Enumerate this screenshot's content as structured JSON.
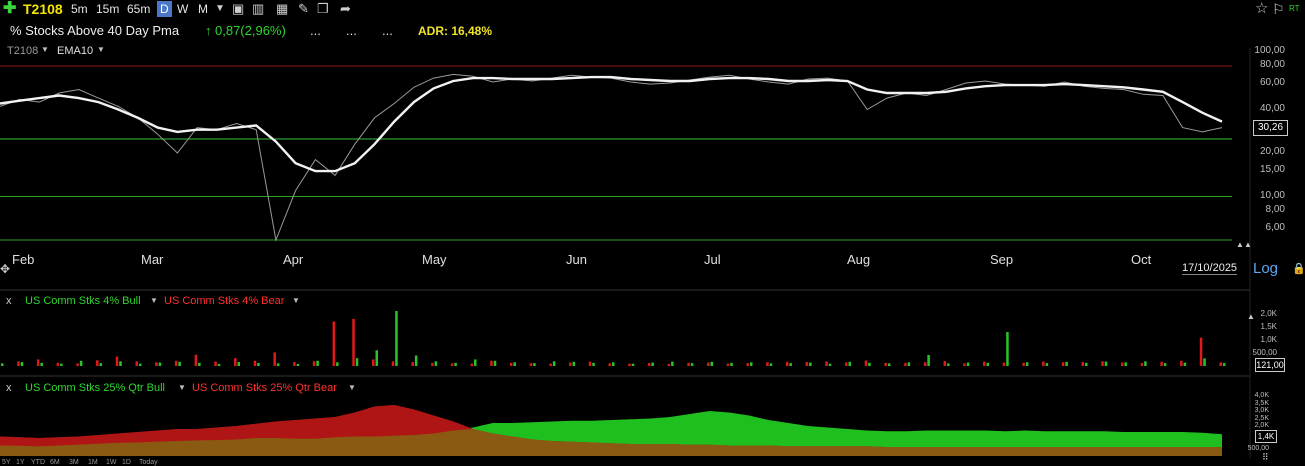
{
  "toolbar": {
    "add_icon": "plus-icon",
    "symbol": "T2108",
    "intervals": [
      "5m",
      "15m",
      "65m"
    ],
    "active_interval": "D",
    "periods": [
      "W",
      "M"
    ],
    "icons": [
      "chart-type-icon",
      "bar-chart-icon",
      "layout-icon",
      "notes-icon",
      "pencil-icon",
      "share-icon"
    ],
    "right_icons": [
      "star-icon",
      "flag-icon"
    ],
    "rt_label": "RT"
  },
  "header": {
    "title": "% Stocks Above 40 Day Pma",
    "change": "0,87(2,96%)",
    "dots": [
      "...",
      "...",
      "..."
    ],
    "adr": "ADR: 16,48%"
  },
  "indicators": {
    "primary": "T2108",
    "secondary": "EMA10"
  },
  "date_label": "17/10/2025",
  "scale_button": "Log",
  "chart_data": [
    {
      "type": "line",
      "title": "% Stocks Above 40 Day Pma",
      "scale": "log",
      "x_labels": [
        "Feb",
        "Mar",
        "Apr",
        "May",
        "Jun",
        "Jul",
        "Aug",
        "Sep",
        "Oct"
      ],
      "y_ticks": [
        "100,00",
        "80,00",
        "60,00",
        "40,00",
        "20,00",
        "15,00",
        "10,00",
        "8,00",
        "6,00"
      ],
      "ylim": [
        5,
        100
      ],
      "last_value": "30,26",
      "horizontal_lines": [
        {
          "value": 80,
          "color": "#8b1a1a"
        },
        {
          "value": 25,
          "color": "#39c239"
        },
        {
          "value": 10,
          "color": "#2aa52a"
        },
        {
          "value": 5,
          "color": "#2aa52a"
        }
      ],
      "series": [
        {
          "name": "T2108",
          "color": "#9a9a9a",
          "values": [
            42,
            47,
            45,
            52,
            55,
            48,
            42,
            35,
            27,
            20,
            30,
            29,
            32,
            29,
            5,
            11,
            18,
            14,
            23,
            35,
            44,
            57,
            66,
            70,
            68,
            62,
            65,
            63,
            66,
            69,
            67,
            66,
            62,
            60,
            61,
            64,
            67,
            69,
            65,
            62,
            60,
            65,
            66,
            63,
            40,
            48,
            52,
            50,
            55,
            61,
            63,
            60,
            59,
            58,
            62,
            58,
            56,
            55,
            51,
            50,
            30,
            28,
            30
          ]
        },
        {
          "name": "EMA10",
          "color": "#f2f2f2",
          "values": [
            44,
            46,
            48,
            50,
            48,
            45,
            40,
            35,
            30,
            28,
            29,
            29,
            30,
            31,
            24,
            17,
            15,
            15,
            17,
            23,
            33,
            45,
            56,
            63,
            66,
            66,
            65,
            65,
            65,
            66,
            67,
            67,
            65,
            64,
            63,
            63,
            65,
            66,
            66,
            65,
            63,
            63,
            64,
            63,
            55,
            52,
            52,
            52,
            53,
            56,
            58,
            59,
            59,
            59,
            60,
            59,
            58,
            57,
            55,
            53,
            45,
            38,
            33
          ]
        }
      ]
    },
    {
      "type": "bar",
      "title": "US Comm Stks 4%",
      "y_ticks": [
        "2,0K",
        "1,5K",
        "1,0K",
        "500,00"
      ],
      "last_value": "121,00",
      "series": [
        {
          "name": "US Comm Stks 4% Bull",
          "color": "#27c627",
          "values": [
            100,
            150,
            120,
            90,
            200,
            110,
            180,
            90,
            130,
            160,
            120,
            80,
            150,
            110,
            100,
            60,
            200,
            140,
            300,
            600,
            2100,
            400,
            180,
            120,
            250,
            200,
            140,
            110,
            180,
            160,
            120,
            140,
            90,
            130,
            170,
            110,
            160,
            120,
            140,
            100,
            110,
            130,
            90,
            160,
            120,
            100,
            140,
            420,
            100,
            130,
            120,
            1300,
            140,
            110,
            160,
            120,
            170,
            140,
            180,
            110,
            130,
            290,
            110
          ]
        },
        {
          "name": "US Comm Stks 4% Bear",
          "color": "#e01919",
          "values": [
            200,
            180,
            250,
            120,
            100,
            220,
            360,
            180,
            140,
            200,
            430,
            170,
            300,
            200,
            520,
            150,
            180,
            1700,
            1800,
            250,
            180,
            150,
            120,
            100,
            90,
            200,
            120,
            110,
            90,
            130,
            170,
            100,
            90,
            110,
            80,
            120,
            130,
            90,
            110,
            140,
            160,
            150,
            170,
            130,
            210,
            120,
            110,
            140,
            190,
            100,
            170,
            130,
            120,
            170,
            140,
            150,
            180,
            130,
            110,
            160,
            200,
            1080,
            140
          ]
        }
      ]
    },
    {
      "type": "area",
      "title": "US Comm Stks 25% Qtr",
      "y_ticks": [
        "4,0K",
        "3,5K",
        "3,0K",
        "2,5K",
        "2,0K",
        "1,5K",
        "1,0K",
        "500,00"
      ],
      "last_value": "1,4K",
      "series": [
        {
          "name": "US Comm Stks 25% Qtr Bull",
          "color": "#1fbf1f",
          "values": [
            700,
            680,
            640,
            700,
            760,
            820,
            880,
            900,
            960,
            1000,
            1040,
            1060,
            1100,
            1200,
            1200,
            1150,
            1150,
            1250,
            1300,
            1300,
            1350,
            1400,
            1500,
            1700,
            1900,
            2200,
            2200,
            2250,
            2300,
            2350,
            2350,
            2400,
            2450,
            2500,
            2600,
            2800,
            3000,
            2900,
            2700,
            2400,
            2200,
            2000,
            1900,
            1800,
            1700,
            1650,
            1650,
            1700,
            1700,
            1700,
            1700,
            1650,
            1700,
            1650,
            1650,
            1650,
            1650,
            1600,
            1600,
            1600,
            1600,
            1550,
            1450
          ]
        },
        {
          "name": "US Comm Stks 25% Qtr Bear",
          "color": "#b01515",
          "values": [
            1300,
            1250,
            1200,
            1250,
            1300,
            1400,
            1500,
            1600,
            1700,
            1800,
            1800,
            1900,
            2000,
            2150,
            2300,
            2400,
            2500,
            2600,
            2900,
            3300,
            3400,
            3100,
            2700,
            2300,
            1800,
            1500,
            1300,
            1100,
            1000,
            950,
            900,
            850,
            800,
            800,
            800,
            750,
            750,
            700,
            700,
            700,
            650,
            650,
            650,
            650,
            650,
            600,
            600,
            600,
            600,
            600,
            600,
            600,
            600,
            600,
            600,
            600,
            600,
            600,
            600,
            600,
            600,
            600,
            600
          ]
        }
      ]
    }
  ],
  "range_buttons": [
    "5Y",
    "1Y",
    "YTD",
    "6M",
    "3M",
    "1M",
    "1W",
    "1D",
    "Today"
  ]
}
